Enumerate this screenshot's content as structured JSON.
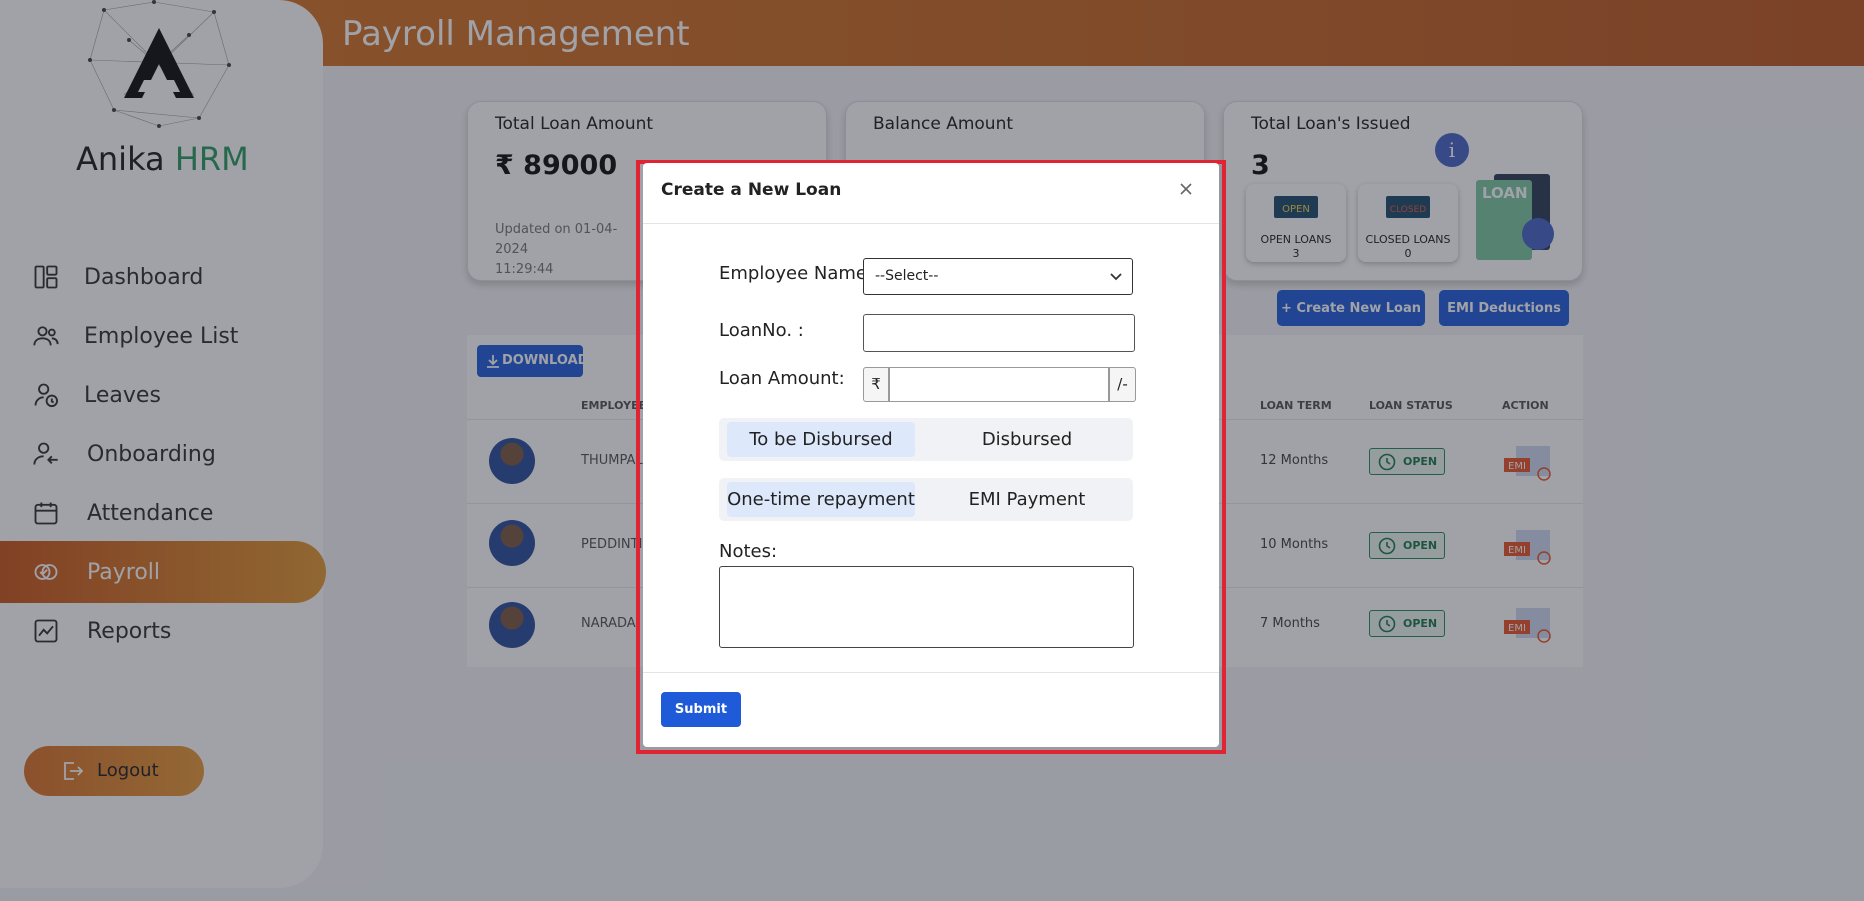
{
  "header": {
    "title": "Payroll Management"
  },
  "brand": {
    "name": "Anika",
    "accent": "HRM"
  },
  "sidebar": {
    "items": [
      {
        "label": "Dashboard",
        "icon": "dashboard-icon"
      },
      {
        "label": "Employee List",
        "icon": "users-icon"
      },
      {
        "label": "Leaves",
        "icon": "leave-icon"
      },
      {
        "label": "Onboarding",
        "icon": "onboarding-icon"
      },
      {
        "label": "Attendance",
        "icon": "calendar-icon"
      },
      {
        "label": "Payroll",
        "icon": "payroll-icon",
        "active": true
      },
      {
        "label": "Reports",
        "icon": "reports-icon"
      }
    ],
    "logout_label": "Logout"
  },
  "cards": {
    "total_loan": {
      "title": "Total Loan Amount",
      "value": "₹ 89000",
      "updated_line1": "Updated on 01-04-2024",
      "updated_line2": "11:29:44"
    },
    "balance": {
      "title": "Balance Amount"
    },
    "issued": {
      "title": "Total Loan's Issued",
      "value": "3",
      "open_badge": "OPEN",
      "closed_badge": "CLOSED",
      "open_label": "OPEN LOANS",
      "open_count": "3",
      "closed_label": "CLOSED LOANS",
      "closed_count": "0"
    }
  },
  "actions": {
    "create_loan": "+ Create New Loan",
    "emi_deductions": "EMI Deductions",
    "download": "DOWNLOAD"
  },
  "table": {
    "headers": {
      "employee": "EMPLOYEE",
      "term": "LOAN TERM",
      "status": "LOAN STATUS",
      "action": "ACTION"
    },
    "rows": [
      {
        "name": "THUMPALA",
        "term": "12 Months",
        "status": "OPEN"
      },
      {
        "name": "PEDDINTI V",
        "term": "10 Months",
        "status": "OPEN"
      },
      {
        "name": "NARADA ",
        "term": "7 Months",
        "status": "OPEN"
      }
    ]
  },
  "modal": {
    "title": "Create a New Loan",
    "employee_label": "Employee Name:",
    "employee_value": "--Select--",
    "loan_no_label": "LoanNo. :",
    "amount_label": "Loan Amount:",
    "currency_prefix": "₹",
    "amount_suffix": "/-",
    "disbursement_options": [
      "To be Disbursed",
      "Disbursed"
    ],
    "repayment_options": [
      "One-time repayment",
      "EMI Payment"
    ],
    "notes_label": "Notes:",
    "submit_label": "Submit"
  },
  "colors": {
    "accent": "#d57829",
    "primary": "#2460d9",
    "success": "#2e9c63",
    "highlight": "#e02433"
  }
}
